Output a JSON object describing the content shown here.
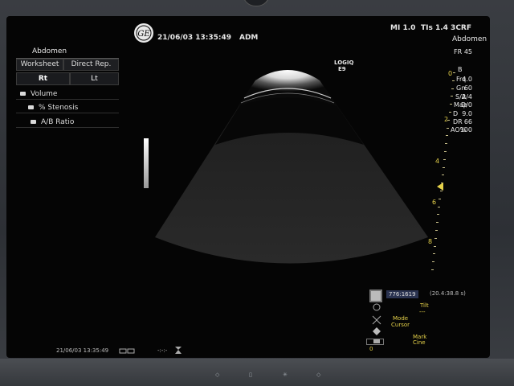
{
  "header": {
    "logo": "GE",
    "datetime": "21/06/03 13:35:49",
    "operator": "ADM",
    "mi": "MI 1.0",
    "tis": "TIs 1.4 3CRF",
    "preset": "Abdomen",
    "fr_label": "FR",
    "fr_value": "45"
  },
  "probe_label": {
    "line1": "LOGIQ",
    "line2": "E9"
  },
  "menu": {
    "title": "Abdomen",
    "tabs": [
      "Worksheet",
      "Direct Rep."
    ],
    "sides": [
      "Rt",
      "Lt"
    ],
    "folders": [
      "Volume",
      "% Stenosis",
      "A/B Ratio"
    ]
  },
  "params": {
    "mode": "B",
    "rows": [
      {
        "label": "Frq",
        "value": "4.0"
      },
      {
        "label": "Gn",
        "value": "60"
      },
      {
        "label": "S/A",
        "value": "2/4"
      },
      {
        "label": "Map",
        "value": "D/0"
      },
      {
        "label": "D",
        "value": "9.0"
      },
      {
        "label": "DR",
        "value": "66"
      },
      {
        "label": "AO%",
        "value": "100"
      }
    ]
  },
  "depth_scale": {
    "labels": [
      "0",
      "2",
      "4",
      "6",
      "8"
    ]
  },
  "cine": {
    "counter": "776:1619",
    "coords": "(20.4:38.8 s)",
    "tilt": "Tilt",
    "tilt_value": "---",
    "mode_cursor_line1": "Mode",
    "mode_cursor_line2": "Cursor",
    "mark_cine_line1": "Mark",
    "mark_cine_line2": "Cine",
    "zero": "0"
  },
  "footer": {
    "datetime": "21/06/03 13:35:49",
    "sep": "-:-:-"
  }
}
